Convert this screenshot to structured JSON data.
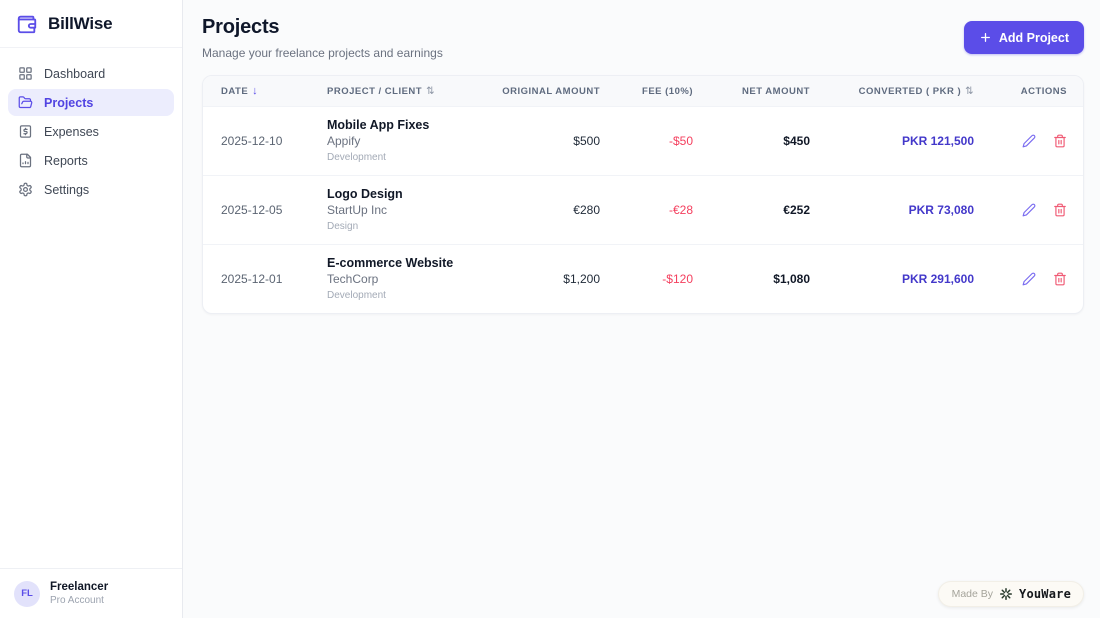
{
  "app": {
    "name": "BillWise"
  },
  "colors": {
    "accent": "#5b4de8",
    "accent_light_bg": "#ecedfd",
    "converted_text": "#4338ca",
    "fee_danger": "#f43f5e",
    "table_header_bg": "#f8f9fb"
  },
  "icons": {
    "sort_desc": "↓",
    "sort_both": "⇅"
  },
  "sidebar": {
    "items": [
      {
        "label": "Dashboard",
        "icon": "grid-icon",
        "active": false
      },
      {
        "label": "Projects",
        "icon": "folder-icon",
        "active": true
      },
      {
        "label": "Expenses",
        "icon": "dollar-receipt-icon",
        "active": false
      },
      {
        "label": "Reports",
        "icon": "file-chart-icon",
        "active": false
      },
      {
        "label": "Settings",
        "icon": "gear-icon",
        "active": false
      }
    ],
    "user": {
      "initials": "FL",
      "name": "Freelancer",
      "plan": "Pro Account"
    }
  },
  "header": {
    "title": "Projects",
    "subtitle": "Manage your freelance projects and earnings",
    "add_button_label": "Add Project"
  },
  "table": {
    "columns": [
      {
        "label": "DATE",
        "sort": "desc"
      },
      {
        "label": "PROJECT / CLIENT",
        "sort": "both"
      },
      {
        "label": "ORIGINAL AMOUNT",
        "sort": null
      },
      {
        "label": "FEE (10%)",
        "sort": null
      },
      {
        "label": "NET AMOUNT",
        "sort": null
      },
      {
        "label": "CONVERTED ( PKR )",
        "sort": "both"
      },
      {
        "label": "ACTIONS",
        "sort": null
      }
    ],
    "rows": [
      {
        "date": "2025-12-10",
        "project": "Mobile App Fixes",
        "client": "Appify",
        "category": "Development",
        "original": "$500",
        "fee": "-$50",
        "net": "$450",
        "converted": "PKR 121,500"
      },
      {
        "date": "2025-12-05",
        "project": "Logo Design",
        "client": "StartUp Inc",
        "category": "Design",
        "original": "€280",
        "fee": "-€28",
        "net": "€252",
        "converted": "PKR 73,080"
      },
      {
        "date": "2025-12-01",
        "project": "E-commerce Website",
        "client": "TechCorp",
        "category": "Development",
        "original": "$1,200",
        "fee": "-$120",
        "net": "$1,080",
        "converted": "PKR 291,600"
      }
    ]
  },
  "badge": {
    "made_by": "Made By",
    "brand": "YouWare"
  }
}
